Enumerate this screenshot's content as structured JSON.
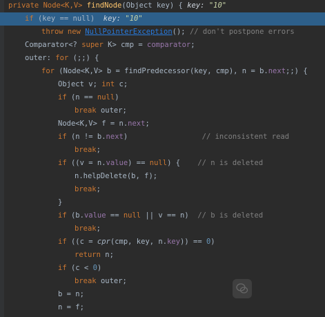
{
  "code_lines": [
    {
      "indent": 0,
      "spans": [
        [
          "private Node<K,V> ",
          "kw"
        ],
        [
          "findNode",
          "fn"
        ],
        [
          "(Object key) { ",
          ""
        ],
        [
          "key: ",
          "inl"
        ],
        [
          "\"10\"",
          "inlstr"
        ]
      ]
    },
    {
      "indent": 1,
      "highlight": true,
      "spans": [
        [
          "if ",
          "kw"
        ],
        [
          "(key == null)  ",
          ""
        ],
        [
          "key: ",
          "inl"
        ],
        [
          "\"10\"",
          "inlstr"
        ]
      ]
    },
    {
      "indent": 2,
      "spans": [
        [
          "throw new ",
          "kw"
        ],
        [
          "NullPointerException",
          "link"
        ],
        [
          "(); ",
          ""
        ],
        [
          "// don't postpone errors",
          "cmt"
        ]
      ]
    },
    {
      "indent": 1,
      "spans": [
        [
          "Comparator<? ",
          ""
        ],
        [
          "super ",
          "kw"
        ],
        [
          "K> cmp = ",
          ""
        ],
        [
          "comparator",
          "fld"
        ],
        [
          ";",
          ""
        ]
      ]
    },
    {
      "indent": 1,
      "spans": [
        [
          "outer: ",
          ""
        ],
        [
          "for ",
          "kw"
        ],
        [
          "(;;) {",
          ""
        ]
      ]
    },
    {
      "indent": 2,
      "spans": [
        [
          "for ",
          "kw"
        ],
        [
          "(Node<K,V> b = findPredecessor(key, cmp), n = b.",
          ""
        ],
        [
          "next",
          "fld"
        ],
        [
          ";;) {",
          ""
        ]
      ]
    },
    {
      "indent": 3,
      "spans": [
        [
          "Object v; ",
          ""
        ],
        [
          "int ",
          "kw"
        ],
        [
          "c;",
          ""
        ]
      ]
    },
    {
      "indent": 3,
      "spans": [
        [
          "if ",
          "kw"
        ],
        [
          "(n == ",
          ""
        ],
        [
          "null",
          "kw"
        ],
        [
          ")",
          ""
        ]
      ]
    },
    {
      "indent": 4,
      "spans": [
        [
          "break ",
          "kw"
        ],
        [
          "outer;",
          ""
        ]
      ]
    },
    {
      "indent": 3,
      "spans": [
        [
          "Node<K,V> f = n.",
          ""
        ],
        [
          "next",
          "fld"
        ],
        [
          ";",
          ""
        ]
      ]
    },
    {
      "indent": 3,
      "spans": [
        [
          "if ",
          "kw"
        ],
        [
          "(n != b.",
          ""
        ],
        [
          "next",
          "fld"
        ],
        [
          ")                 ",
          ""
        ],
        [
          "// inconsistent read",
          "cmt"
        ]
      ]
    },
    {
      "indent": 4,
      "spans": [
        [
          "break",
          "kw"
        ],
        [
          ";",
          ""
        ]
      ]
    },
    {
      "indent": 3,
      "spans": [
        [
          "if ",
          "kw"
        ],
        [
          "((v = n.",
          ""
        ],
        [
          "value",
          "fld"
        ],
        [
          ") == ",
          ""
        ],
        [
          "null",
          "kw"
        ],
        [
          ") {    ",
          ""
        ],
        [
          "// n is deleted",
          "cmt"
        ]
      ]
    },
    {
      "indent": 4,
      "spans": [
        [
          "n.helpDelete(b, f);",
          ""
        ]
      ]
    },
    {
      "indent": 4,
      "spans": [
        [
          "break",
          "kw"
        ],
        [
          ";",
          ""
        ]
      ]
    },
    {
      "indent": 3,
      "spans": [
        [
          "}",
          ""
        ]
      ]
    },
    {
      "indent": 3,
      "spans": [
        [
          "if ",
          "kw"
        ],
        [
          "(b.",
          ""
        ],
        [
          "value",
          "fld"
        ],
        [
          " == ",
          ""
        ],
        [
          "null ",
          "kw"
        ],
        [
          "|| v == n)  ",
          ""
        ],
        [
          "// b is deleted",
          "cmt"
        ]
      ]
    },
    {
      "indent": 4,
      "spans": [
        [
          "break",
          "kw"
        ],
        [
          ";",
          ""
        ]
      ]
    },
    {
      "indent": 3,
      "spans": [
        [
          "if ",
          "kw"
        ],
        [
          "((c = ",
          ""
        ],
        [
          "cpr",
          "ital"
        ],
        [
          "(cmp, key, n.",
          ""
        ],
        [
          "key",
          "fld"
        ],
        [
          ")) == ",
          ""
        ],
        [
          "0",
          "cls"
        ],
        [
          ")",
          ""
        ]
      ]
    },
    {
      "indent": 4,
      "spans": [
        [
          "return ",
          "kw"
        ],
        [
          "n;",
          ""
        ]
      ]
    },
    {
      "indent": 3,
      "spans": [
        [
          "if ",
          "kw"
        ],
        [
          "(c < ",
          ""
        ],
        [
          "0",
          "cls"
        ],
        [
          ")",
          ""
        ]
      ]
    },
    {
      "indent": 4,
      "spans": [
        [
          "break ",
          "kw"
        ],
        [
          "outer;",
          ""
        ]
      ]
    },
    {
      "indent": 3,
      "spans": [
        [
          "b = n;",
          ""
        ]
      ]
    },
    {
      "indent": 3,
      "spans": [
        [
          "n = f;",
          ""
        ]
      ]
    }
  ]
}
